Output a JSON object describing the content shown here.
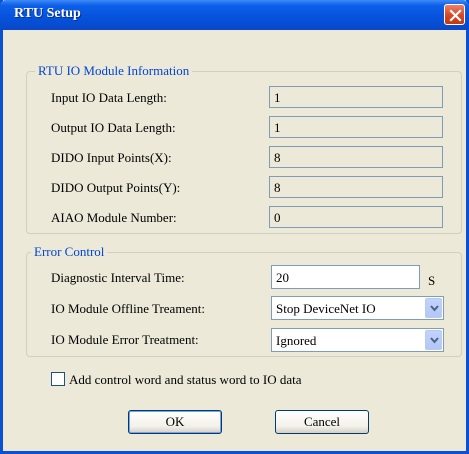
{
  "window": {
    "title": "RTU Setup"
  },
  "io_info": {
    "legend": "RTU IO Module Information",
    "rows": [
      {
        "label": "Input IO Data Length:",
        "value": "1"
      },
      {
        "label": "Output IO Data Length:",
        "value": "1"
      },
      {
        "label": "DIDO Input Points(X):",
        "value": "8"
      },
      {
        "label": "DIDO Output Points(Y):",
        "value": "8"
      },
      {
        "label": "AIAO Module Number:",
        "value": "0"
      }
    ]
  },
  "error_control": {
    "legend": "Error Control",
    "diagnostic": {
      "label": "Diagnostic Interval Time:",
      "value": "20",
      "unit": "S"
    },
    "offline": {
      "label": "IO Module Offline Treament:",
      "value": "Stop DeviceNet IO"
    },
    "error": {
      "label": "IO Module Error Treatment:",
      "value": "Ignored"
    }
  },
  "checkbox": {
    "label": "Add control word and status word to IO data",
    "checked": false
  },
  "buttons": {
    "ok": "OK",
    "cancel": "Cancel"
  },
  "colors": {
    "title_bar": "#0552db",
    "legend_text": "#0046d5",
    "close_button": "#d9471f",
    "dialog_bg": "#ece9d8"
  }
}
